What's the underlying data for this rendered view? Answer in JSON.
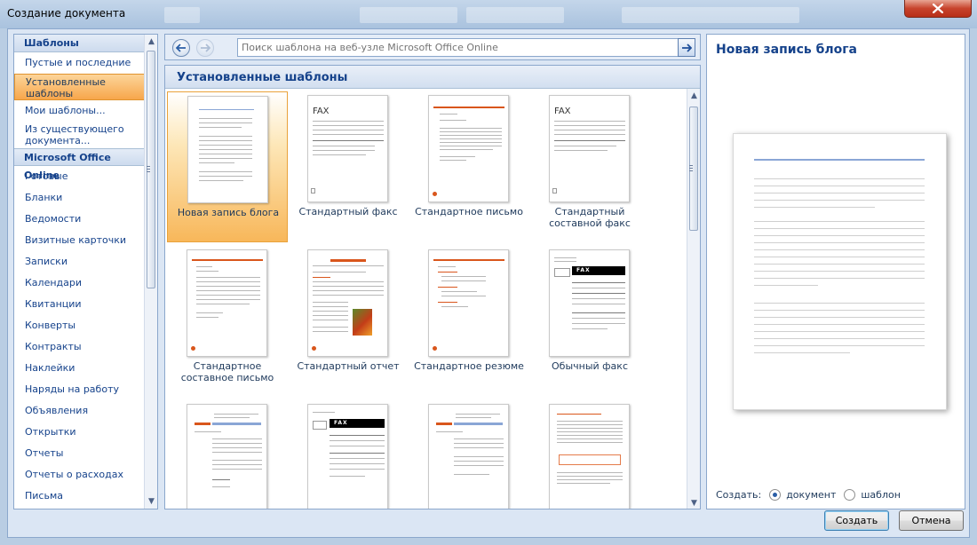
{
  "window": {
    "title": "Создание документа",
    "close_icon": "close-icon"
  },
  "sidebar": {
    "header_templates": "Шаблоны",
    "items_top": [
      {
        "label": "Пустые и последние",
        "selected": false
      },
      {
        "label": "Установленные шаблоны",
        "selected": true
      },
      {
        "label": "Мои шаблоны...",
        "selected": false
      },
      {
        "label": "Из существующего документа...",
        "selected": false
      }
    ],
    "header_online": "Microsoft Office Online",
    "items_online": [
      "Готовые",
      "Бланки",
      "Ведомости",
      "Визитные карточки",
      "Записки",
      "Календари",
      "Квитанции",
      "Конверты",
      "Контракты",
      "Наклейки",
      "Наряды на работу",
      "Объявления",
      "Открытки",
      "Отчеты",
      "Отчеты о расходах",
      "Письма"
    ]
  },
  "search": {
    "placeholder": "Поиск шаблона на веб-узле Microsoft Office Online",
    "back_icon": "back-arrow-icon",
    "forward_icon": "forward-arrow-icon",
    "go_icon": "go-arrow-icon"
  },
  "gallery": {
    "title": "Установленные шаблоны",
    "templates": [
      "Новая запись блога",
      "Стандартный факс",
      "Стандартное письмо",
      "Стандартный составной факс",
      "Стандартное составное письмо",
      "Стандартный отчет",
      "Стандартное резюме",
      "Обычный факс"
    ],
    "fax_word": "FAX"
  },
  "preview": {
    "title": "Новая запись блога",
    "create_label": "Создать:",
    "option_document": "документ",
    "option_template": "шаблон",
    "selected_option": "документ"
  },
  "buttons": {
    "create": "Создать",
    "cancel": "Отмена"
  },
  "colors": {
    "accent_selected": "#f7a64b",
    "header_text": "#15428b",
    "frame": "#b9cde3"
  }
}
